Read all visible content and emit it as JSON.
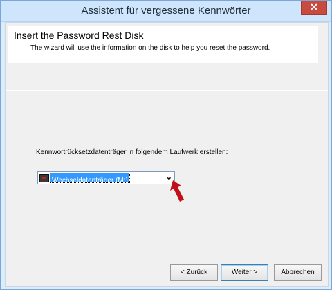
{
  "window": {
    "title": "Assistent für vergessene Kennwörter",
    "close_label": "✕"
  },
  "header": {
    "title": "Insert the Password Rest Disk",
    "description": "The wizard will use the information on the disk to help you reset the password."
  },
  "drive": {
    "label": "Kennwortrücksetzdatenträger in folgendem Laufwerk erstellen:",
    "selected": "Wechseldatenträger (M:)"
  },
  "buttons": {
    "back": "< Zurück",
    "next": "Weiter >",
    "cancel": "Abbrechen"
  },
  "colors": {
    "accent": "#3399ff",
    "annotation_arrow": "#c0111b",
    "title_bg": "#cfe5fb"
  }
}
